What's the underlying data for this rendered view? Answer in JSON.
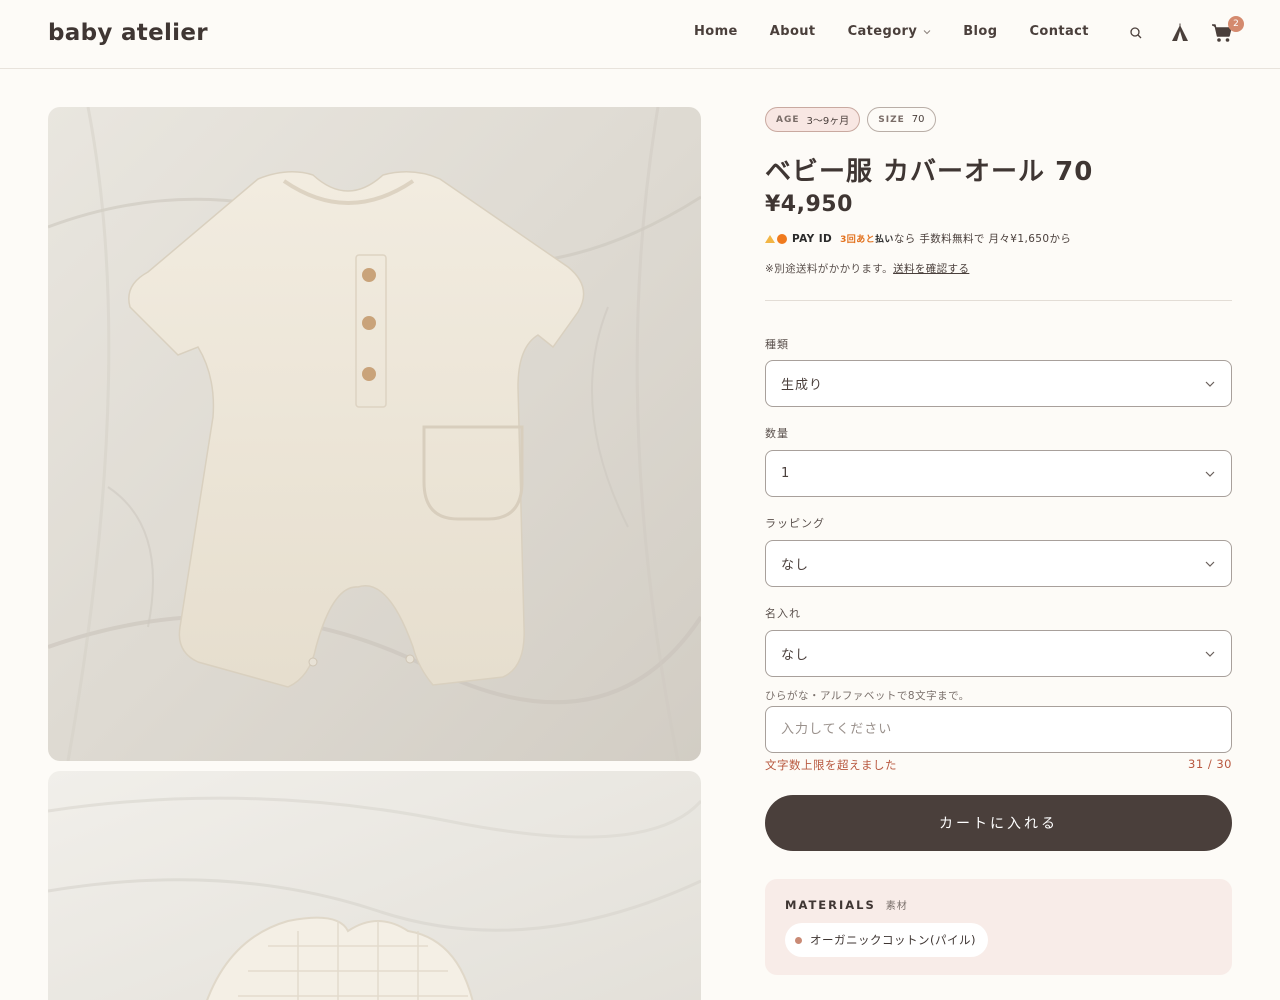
{
  "header": {
    "logo": "baby atelier",
    "nav": [
      "Home",
      "About",
      "Category",
      "Blog",
      "Contact"
    ],
    "cart_count": "2",
    "icons": [
      "search-icon",
      "tent-icon",
      "cart-icon"
    ]
  },
  "product": {
    "tags": [
      {
        "key": "AGE",
        "value": "3〜9ヶ月"
      },
      {
        "key": "SIZE",
        "value": "70"
      }
    ],
    "title": "ベビー服 カバーオール 70",
    "price": "¥4,950",
    "payid": {
      "brand": "PAY ID",
      "highlight1": "3回あと",
      "highlight2": "払い",
      "text": "なら 手数料無料で 月々¥1,650から"
    },
    "shipping_note": "※別途送料がかかります。",
    "shipping_link": "送料を確認する"
  },
  "options": {
    "type": {
      "label": "種類",
      "value": "生成り"
    },
    "quantity": {
      "label": "数量",
      "value": "1"
    },
    "wrapping": {
      "label": "ラッピング",
      "value": "なし"
    },
    "naming": {
      "label": "名入れ",
      "value": "なし"
    },
    "name_hint": "ひらがな・アルファベットで8文字まで。",
    "name_placeholder": "入力してください",
    "error": "文字数上限を超えました",
    "counter": "31 / 30"
  },
  "cart_button": "カートに入れる",
  "materials": {
    "title": "MATERIALS",
    "subtitle": "素材",
    "item": "オーガニックコットン(パイル)"
  },
  "colors": {
    "background": "#fdfbf7",
    "text": "#4a3f3b",
    "button": "#4a3f3b",
    "error": "#b8583f",
    "accent": "#d48a6e",
    "materials_bg": "#f8ece8"
  }
}
